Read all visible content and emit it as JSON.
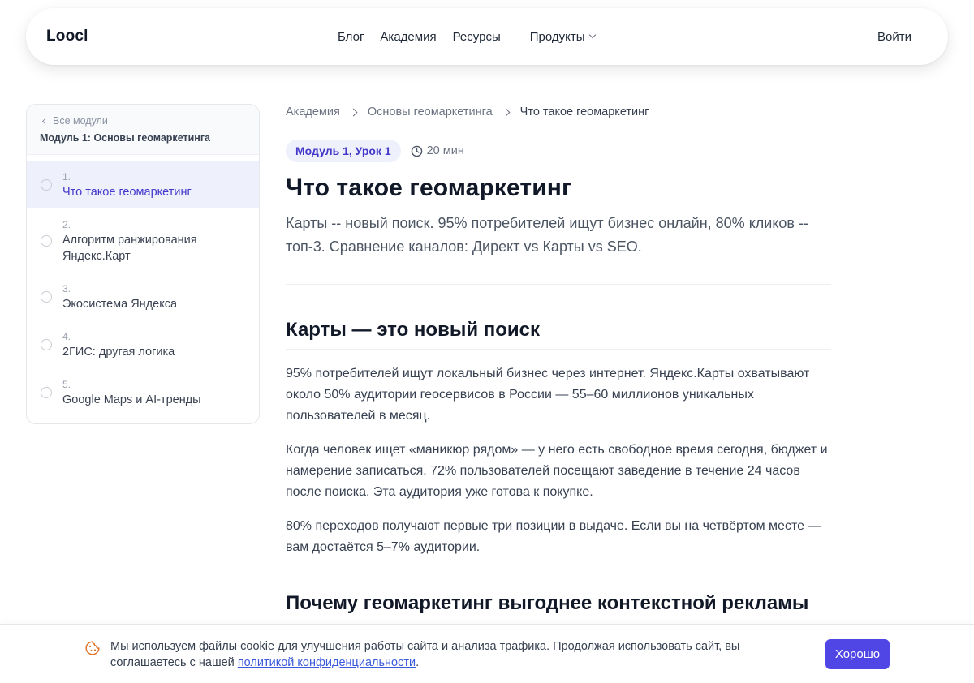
{
  "header": {
    "logo": "Loocl",
    "nav": [
      "Блог",
      "Академия",
      "Ресурсы"
    ],
    "products": "Продукты",
    "login": "Войти"
  },
  "sidebar": {
    "back": "Все модули",
    "module_title": "Модуль 1: Основы геомаркетинга",
    "lessons": [
      {
        "num": "1.",
        "title": "Что такое геомаркетинг",
        "active": true
      },
      {
        "num": "2.",
        "title": "Алгоритм ранжирования Яндекс.Карт"
      },
      {
        "num": "3.",
        "title": "Экосистема Яндекса"
      },
      {
        "num": "4.",
        "title": "2ГИС: другая логика"
      },
      {
        "num": "5.",
        "title": "Google Maps и AI-тренды"
      }
    ]
  },
  "breadcrumb": [
    "Академия",
    "Основы геомаркетинга",
    "Что такое геомаркетинг"
  ],
  "lesson": {
    "badge": "Модуль 1, Урок 1",
    "duration": "20 мин",
    "title": "Что такое геомаркетинг",
    "lead": "Карты -- новый поиск. 95% потребителей ищут бизнес онлайн, 80% кликов -- топ-3. Сравнение каналов: Директ vs Карты vs SEO.",
    "section1_title": "Карты — это новый поиск",
    "paragraphs": [
      "95% потребителей ищут локальный бизнес через интернет. Яндекс.Карты охватывают около 50% аудитории геосервисов в России — 55–60 миллионов уникальных пользователей в месяц.",
      "Когда человек ищет «маникюр рядом» — у него есть свободное время сегодня, бюджет и намерение записаться. 72% пользователей посещают заведение в течение 24 часов после поиска. Эта аудитория уже готова к покупке.",
      "80% переходов получают первые три позиции в выдаче. Если вы на четвёртом месте — вам достаётся 5–7% аудитории."
    ],
    "section2_title": "Почему геомаркетинг выгоднее контекстной рекламы"
  },
  "cookie": {
    "text": "Мы используем файлы cookie для улучшения работы сайта и анализа трафика. Продолжая использовать сайт, вы соглашаетесь с нашей",
    "link": "политикой конфиденциальности",
    "end": ".",
    "button": "Хорошо"
  },
  "colors": {
    "accent": "#4f46e5",
    "active_text": "#4438ca",
    "active_bg": "#eef0fc",
    "cookie_icon": "#e0742b"
  }
}
